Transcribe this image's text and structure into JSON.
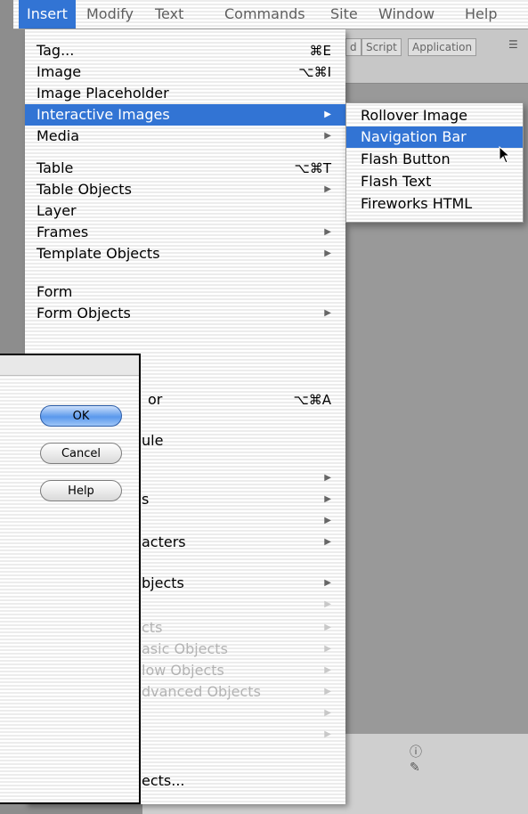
{
  "menubar": {
    "items": [
      "Insert",
      "Modify",
      "Text",
      "Commands",
      "Site",
      "Window",
      "Help"
    ]
  },
  "doc_tabs": [
    "d",
    "Script",
    "Application"
  ],
  "insert_menu": {
    "items": [
      {
        "label": "Tag...",
        "shortcut": "⌘E"
      },
      {
        "label": "Image",
        "shortcut": "⌥⌘I"
      },
      {
        "label": "Image Placeholder",
        "shortcut": ""
      },
      {
        "label": "Interactive Images",
        "shortcut": "▶"
      },
      {
        "label": "Media",
        "shortcut": "▶"
      },
      {
        "label": "Table",
        "shortcut": "⌥⌘T"
      },
      {
        "label": "Table Objects",
        "shortcut": "▶"
      },
      {
        "label": "Layer",
        "shortcut": ""
      },
      {
        "label": "Frames",
        "shortcut": "▶"
      },
      {
        "label": "Template Objects",
        "shortcut": "▶"
      },
      {
        "label": "Form",
        "shortcut": ""
      },
      {
        "label": "Form Objects",
        "shortcut": "▶"
      },
      {
        "label": "or",
        "shortcut": "⌥⌘A"
      },
      {
        "label": "ule",
        "shortcut": ""
      },
      {
        "label": "",
        "shortcut": "▶"
      },
      {
        "label": "s",
        "shortcut": "▶"
      },
      {
        "label": "",
        "shortcut": "▶"
      },
      {
        "label": "acters",
        "shortcut": "▶"
      },
      {
        "label": "bjects",
        "shortcut": "▶"
      },
      {
        "label": "",
        "shortcut": "▶"
      },
      {
        "label": "cts",
        "shortcut": "▶"
      },
      {
        "label": "asic Objects",
        "shortcut": "▶"
      },
      {
        "label": "low Objects",
        "shortcut": "▶"
      },
      {
        "label": "dvanced Objects",
        "shortcut": "▶"
      },
      {
        "label": "",
        "shortcut": "▶"
      },
      {
        "label": "",
        "shortcut": "▶"
      },
      {
        "label": "ects...",
        "shortcut": ""
      }
    ]
  },
  "submenu": {
    "items": [
      "Rollover Image",
      "Navigation Bar",
      "Flash Button",
      "Flash Text",
      "Fireworks HTML"
    ]
  },
  "dialog": {
    "ok_label": "OK",
    "cancel_label": "Cancel",
    "help_label": "Help"
  },
  "colors": {
    "highlight": "#3274d4"
  }
}
